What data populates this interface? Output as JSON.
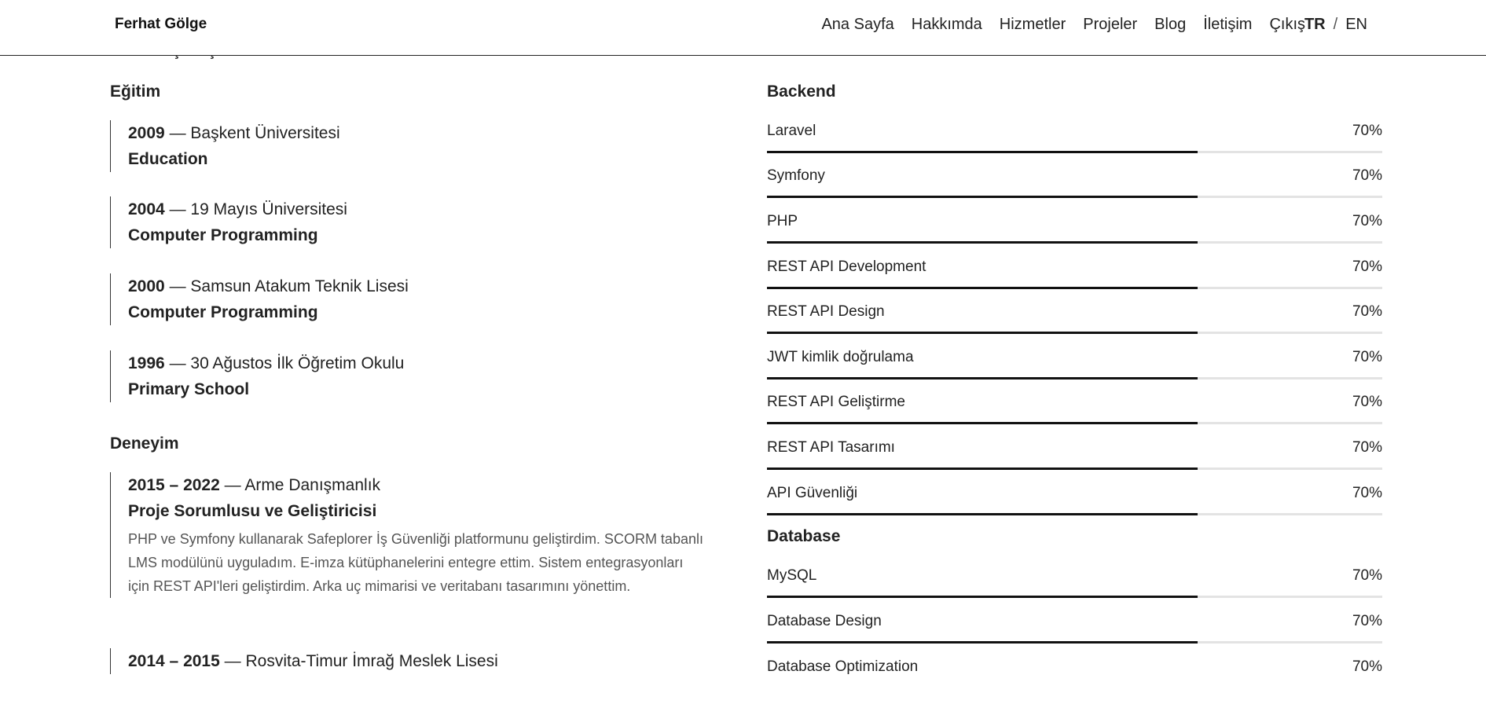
{
  "header": {
    "brand": "Ferhat Gölge",
    "nav": [
      "Ana Sayfa",
      "Hakkımda",
      "Hizmetler",
      "Projeler",
      "Blog",
      "İletişim",
      "Çıkış"
    ],
    "lang": {
      "active": "TR",
      "separator": "/",
      "other": "EN"
    }
  },
  "resume": {
    "cut_heading": "ÖZ GEÇMİŞ",
    "education_title": "Eğitim",
    "education": [
      {
        "year": "2009",
        "school": "— Başkent Üniversitesi",
        "field": "Education"
      },
      {
        "year": "2004",
        "school": "— 19 Mayıs Üniversitesi",
        "field": "Computer Programming"
      },
      {
        "year": "2000",
        "school": "— Samsun Atakum Teknik Lisesi",
        "field": "Computer Programming"
      },
      {
        "year": "1996",
        "school": "— 30 Ağustos İlk Öğretim Okulu",
        "field": "Primary School"
      }
    ],
    "experience_title": "Deneyim",
    "experience": [
      {
        "years": "2015 – 2022",
        "company": "— Arme Danışmanlık",
        "role": "Proje Sorumlusu ve Geliştiricisi",
        "description": "PHP ve Symfony kullanarak Safeplorer İş Güvenliği platformunu geliştirdim. SCORM tabanlı LMS modülünü uyguladım. E-imza kütüphanelerini entegre ettim. Sistem entegrasyonları için REST API'leri geliştirdim. Arka uç mimarisi ve veritabanı tasarımını yönettim."
      },
      {
        "years": "2014 – 2015",
        "company": "— Rosvita-Timur İmrağ Meslek Lisesi"
      }
    ]
  },
  "skills": {
    "backend_title": "Backend",
    "backend": [
      {
        "name": "Laravel",
        "pct": "70%",
        "level": 0.7
      },
      {
        "name": "Symfony",
        "pct": "70%",
        "level": 0.7
      },
      {
        "name": "PHP",
        "pct": "70%",
        "level": 0.7
      },
      {
        "name": "REST API Development",
        "pct": "70%",
        "level": 0.7
      },
      {
        "name": "REST API Design",
        "pct": "70%",
        "level": 0.7
      },
      {
        "name": "JWT kimlik doğrulama",
        "pct": "70%",
        "level": 0.7
      },
      {
        "name": "REST API Geliştirme",
        "pct": "70%",
        "level": 0.7
      },
      {
        "name": "REST API Tasarımı",
        "pct": "70%",
        "level": 0.7
      },
      {
        "name": "API Güvenliği",
        "pct": "70%",
        "level": 0.7
      }
    ],
    "database_title": "Database",
    "database": [
      {
        "name": "MySQL",
        "pct": "70%",
        "level": 0.7
      },
      {
        "name": "Database Design",
        "pct": "70%",
        "level": 0.7
      },
      {
        "name": "Database Optimization",
        "pct": "70%",
        "level": 0.7
      }
    ]
  }
}
